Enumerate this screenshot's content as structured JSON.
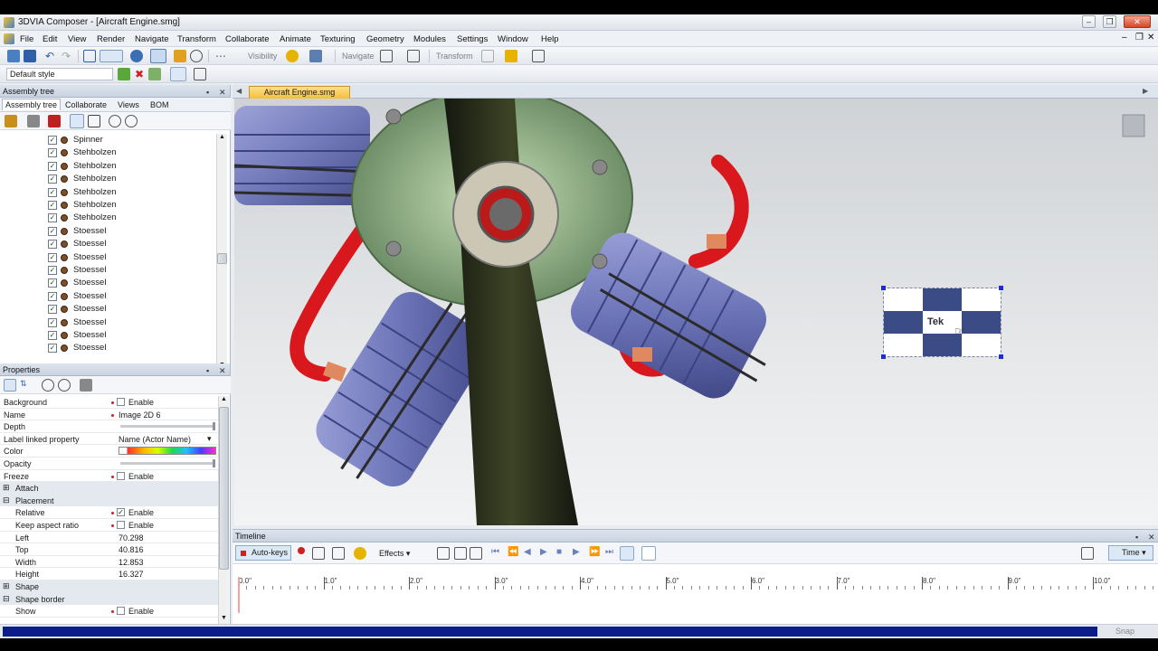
{
  "window": {
    "title": "3DVIA Composer - [Aircraft Engine.smg]",
    "controls": [
      "–",
      "❐",
      "✕"
    ]
  },
  "menu": [
    "File",
    "Edit",
    "View",
    "Render",
    "Navigate",
    "Transform",
    "Collaborate",
    "Animate",
    "Texturing",
    "Geometry",
    "Modules",
    "Settings",
    "Window",
    "Help"
  ],
  "toolbar": {
    "visibility_label": "Visibility",
    "navigate_label": "Navigate",
    "transform_label": "Transform",
    "style_value": "Default style"
  },
  "assembly": {
    "title": "Assembly tree",
    "tabs": [
      "Assembly tree",
      "Collaborate",
      "Views",
      "BOM"
    ],
    "items": [
      "Spinner",
      "Stehbolzen",
      "Stehbolzen",
      "Stehbolzen",
      "Stehbolzen",
      "Stehbolzen",
      "Stehbolzen",
      "Stoessel",
      "Stoessel",
      "Stoessel",
      "Stoessel",
      "Stoessel",
      "Stoessel",
      "Stoessel",
      "Stoessel",
      "Stoessel",
      "Stoessel"
    ]
  },
  "properties": {
    "title": "Properties",
    "rows": [
      {
        "key": "Background",
        "value": "Enable",
        "type": "check",
        "checked": false
      },
      {
        "key": "Name",
        "value": "Image 2D 6",
        "type": "text"
      },
      {
        "key": "Depth",
        "value": "",
        "type": "slider",
        "level": 1.0
      },
      {
        "key": "Label linked property",
        "value": "Name (Actor Name)",
        "type": "select"
      },
      {
        "key": "Color",
        "value": "",
        "type": "color"
      },
      {
        "key": "Opacity",
        "value": "",
        "type": "slider",
        "level": 1.0
      },
      {
        "key": "Freeze",
        "value": "Enable",
        "type": "check",
        "checked": false
      },
      {
        "key": "Attach",
        "value": "",
        "type": "cat"
      },
      {
        "key": "Placement",
        "value": "",
        "type": "cat-open"
      },
      {
        "key": "Relative",
        "value": "Enable",
        "type": "check",
        "checked": true
      },
      {
        "key": "Keep aspect ratio",
        "value": "Enable",
        "type": "check",
        "checked": false
      },
      {
        "key": "Left",
        "value": "70.298",
        "type": "text"
      },
      {
        "key": "Top",
        "value": "40.816",
        "type": "text"
      },
      {
        "key": "Width",
        "value": "12.853",
        "type": "text"
      },
      {
        "key": "Height",
        "value": "16.327",
        "type": "text"
      },
      {
        "key": "Shape",
        "value": "",
        "type": "cat"
      },
      {
        "key": "Shape border",
        "value": "",
        "type": "cat-open"
      },
      {
        "key": "Show",
        "value": "Enable",
        "type": "check",
        "checked": false
      }
    ]
  },
  "document_tab": "Aircraft Engine.smg",
  "overlay_image_text": "Tek",
  "timeline": {
    "title": "Timeline",
    "autokeys_label": "Auto-keys",
    "effects_label": "Effects",
    "time_label": "Time",
    "ticks": [
      "0.0\"",
      "1.0\"",
      "2.0\"",
      "3.0\"",
      "4.0\"",
      "5.0\"",
      "6.0\"",
      "7.0\"",
      "8.0\"",
      "9.0\"",
      "10.0\""
    ]
  },
  "status": {
    "snap_label": "Snap"
  },
  "colors": {
    "accent": "#0b1d8a",
    "tab_active": "#f7c94a",
    "cylinder": "#6c74b8",
    "pipe": "#d8181c"
  }
}
